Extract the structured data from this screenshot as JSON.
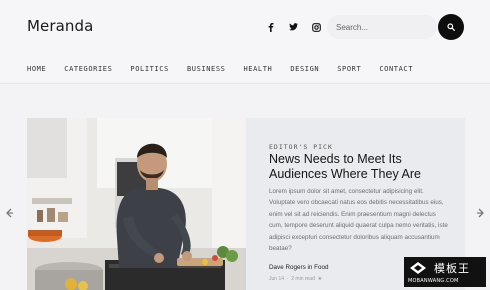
{
  "header": {
    "logo": "Meranda",
    "search_placeholder": "Search...",
    "social": [
      "facebook-icon",
      "twitter-icon",
      "instagram-icon"
    ]
  },
  "nav": [
    "HOME",
    "CATEGORIES",
    "POLITICS",
    "BUSINESS",
    "HEALTH",
    "DESIGN",
    "SPORT",
    "CONTACT"
  ],
  "featured": {
    "kicker": "EDITOR'S PICK",
    "title": "News Needs to Meet Its Audiences Where They Are",
    "excerpt": "Lorem ipsum dolor sit amet, consectetur adipisicing elit. Voluptate vero obcaecati natus eos debitis necessitatibus eius, enim vel sit ad reiciendis. Enim praesentium magni delectus cum, tempore deserunt aliquid quaerat culpa nemo veritatis, iste adipisci excepturi consectetur doloribus aliquam accusantium beatae?",
    "author": "Dave Rogers",
    "in_word": "in",
    "category": "Food",
    "date": "Jun 14",
    "read_time": "2 min read"
  },
  "watermark": {
    "text": "模板王",
    "sub": "MOBANWANG.COM"
  },
  "colors": {
    "accent": "#0d0d0d",
    "card_bg": "#e9ebee",
    "page_bg": "#f3f3f5"
  }
}
